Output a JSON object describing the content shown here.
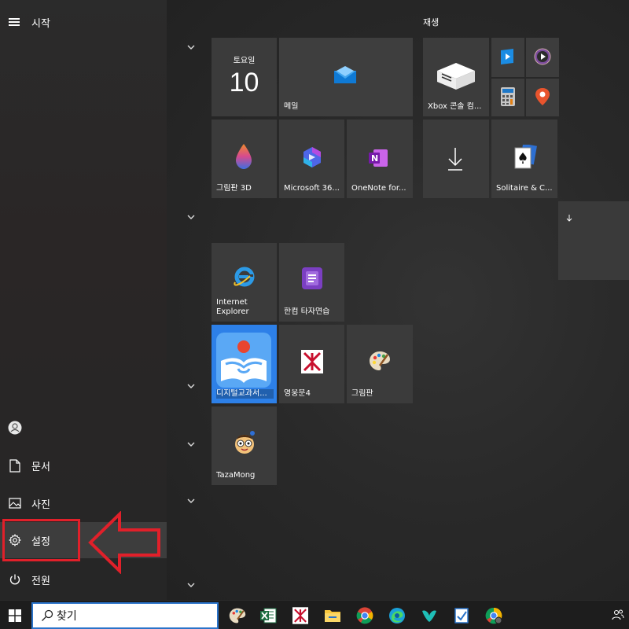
{
  "start_menu": {
    "title": "시작",
    "rail_items": [
      {
        "label": "문서",
        "icon": "document-icon"
      },
      {
        "label": "사진",
        "icon": "pictures-icon"
      },
      {
        "label": "설정",
        "icon": "gear-icon"
      },
      {
        "label": "전원",
        "icon": "power-icon"
      }
    ],
    "group_label": "재생",
    "calendar": {
      "day_name": "토요일",
      "day_number": "10"
    },
    "tiles": {
      "mail": "메일",
      "paint3d": "그림판 3D",
      "m365": "Microsoft 36...",
      "onenote": "OneNote for...",
      "xbox": "Xbox 콘솔 컴...",
      "solitaire": "Solitaire & C...",
      "ie": "Internet Explorer",
      "hanword": "한컴 타자연습",
      "textbook": "디지털교과서...",
      "yeongung": "영웅문4",
      "paint": "그림판",
      "tazamong": "TazaMong"
    }
  },
  "taskbar": {
    "search_placeholder": "찾기"
  },
  "colors": {
    "accent_highlight": "#e1202a",
    "search_border": "#2a73c9"
  }
}
